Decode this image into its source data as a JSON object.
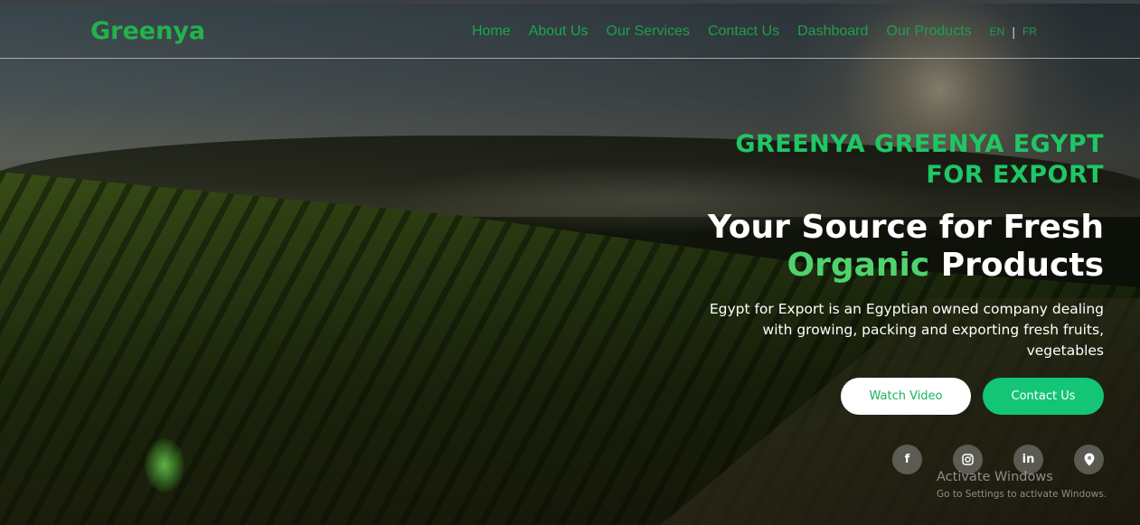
{
  "navbar": {
    "brand": "Greenya",
    "links": [
      {
        "label": "Home"
      },
      {
        "label": "About Us"
      },
      {
        "label": "Our Services"
      },
      {
        "label": "Contact Us"
      },
      {
        "label": "Dashboard"
      },
      {
        "label": "Our Products"
      }
    ],
    "languages": {
      "current": "EN",
      "separator": "|",
      "other": "FR"
    }
  },
  "hero": {
    "company_line1": "GREENYA GREENYA EGYPT",
    "company_line2": "FOR EXPORT",
    "headline_part1": "Your Source for Fresh",
    "headline_accent": "Organic",
    "headline_part2": "Products",
    "description": "Egypt for Export is an Egyptian owned company dealing with growing, packing and exporting fresh fruits, vegetables",
    "watch_video_label": "Watch Video",
    "contact_label": "Contact Us"
  },
  "socials": [
    {
      "icon": "facebook-icon",
      "glyph": "f"
    },
    {
      "icon": "instagram-icon",
      "glyph": ""
    },
    {
      "icon": "linkedin-icon",
      "glyph": "in"
    },
    {
      "icon": "location-pin-icon",
      "glyph": ""
    }
  ],
  "watermark": {
    "title": "Activate Windows",
    "subtitle": "Go to Settings to activate Windows."
  },
  "colors": {
    "brand_green": "#22b24c",
    "accent_green": "#1fc764",
    "button_green": "#13c575"
  }
}
